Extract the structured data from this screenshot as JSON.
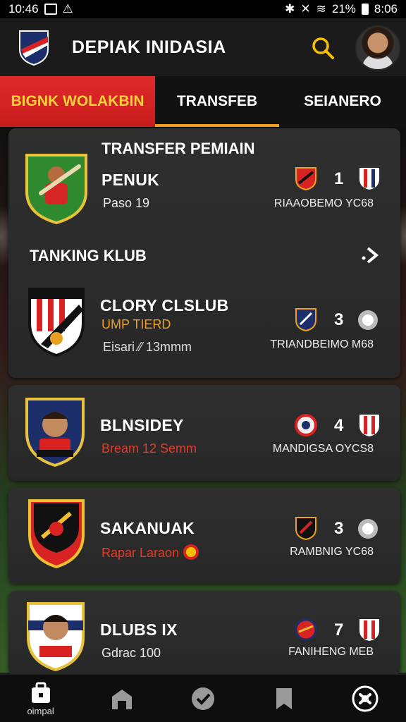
{
  "status_bar": {
    "time_left": "10:46",
    "battery": "21%",
    "time_right": "8:06"
  },
  "header": {
    "app_title": "DEPIAK INIDASIA"
  },
  "tabs": [
    {
      "label": "BIGNK WOLAKBIN",
      "active": true
    },
    {
      "label": "TRANSFEB",
      "active": false
    },
    {
      "label": "SEIANERO",
      "active": false
    }
  ],
  "transfer_section": {
    "title": "TRANSFER PEMIAIN",
    "player_name": "PENUK",
    "player_sub": "Paso 19",
    "score": "1",
    "match_label": "RIAAOBEMO YC68"
  },
  "ranking_section": {
    "title": "TANKING KLUB"
  },
  "clubs": [
    {
      "name": "CLORY CLSLUB",
      "sub": "UMP TIERD",
      "meta": "Eisari ⁄⁄ 13mmm",
      "score": "3",
      "match_label": "TRIANDBEIMO M68"
    },
    {
      "name": "BLNSIDEY",
      "sub": "Bream 12 Semm",
      "score": "4",
      "match_label": "MANDIGSA OYCS8"
    },
    {
      "name": "SAKANUAK",
      "sub": "Rapar Laraon",
      "score": "3",
      "match_label": "RAMBNIG YC68"
    },
    {
      "name": "DLUBS IX",
      "sub": "Gdrac 100",
      "score": "7",
      "match_label": "FANIHENG MEB"
    }
  ],
  "bottom_nav": [
    {
      "icon": "bag-icon",
      "label": "oimpal"
    },
    {
      "icon": "home-icon",
      "label": ""
    },
    {
      "icon": "check-circle-icon",
      "label": ""
    },
    {
      "icon": "bookmark-icon",
      "label": ""
    },
    {
      "icon": "soccer-ball-icon",
      "label": ""
    }
  ],
  "colors": {
    "accent_red": "#d92323",
    "accent_yellow": "#ffd23a",
    "accent_orange": "#f0a020",
    "card_bg": "#2b2b2b"
  }
}
